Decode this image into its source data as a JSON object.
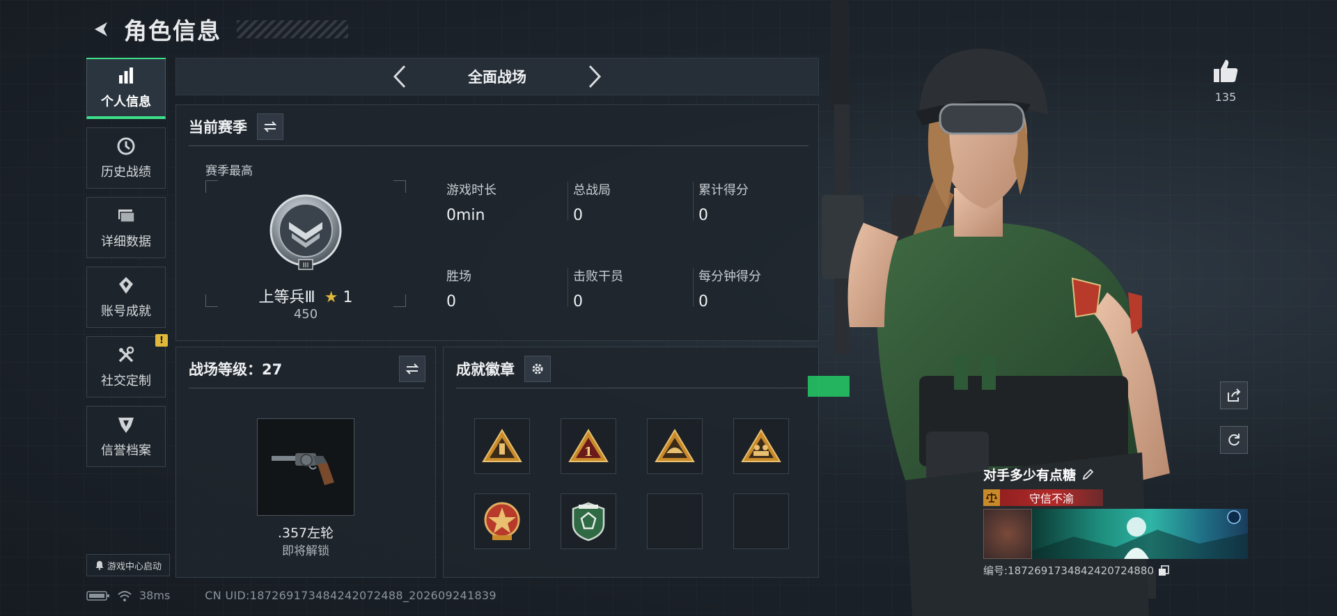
{
  "header": {
    "title": "角色信息"
  },
  "sidebar": {
    "items": [
      {
        "label": "个人信息",
        "icon": "bar-chart-icon"
      },
      {
        "label": "历史战绩",
        "icon": "clock-icon"
      },
      {
        "label": "详细数据",
        "icon": "folder-icon"
      },
      {
        "label": "账号成就",
        "icon": "achievement-icon"
      },
      {
        "label": "社交定制",
        "icon": "tools-icon",
        "badge": "!"
      },
      {
        "label": "信誉档案",
        "icon": "credit-shield-icon"
      }
    ],
    "launch_label": "游戏中心启动"
  },
  "mode_bar": {
    "title": "全面战场"
  },
  "season_panel": {
    "title": "当前赛季",
    "best_label": "赛季最高",
    "rank_name": "上等兵Ⅲ",
    "rank_stars": "1",
    "rank_score": "450",
    "stats": [
      {
        "label": "游戏时长",
        "value": "0min"
      },
      {
        "label": "总战局",
        "value": "0"
      },
      {
        "label": "累计得分",
        "value": "0"
      },
      {
        "label": "胜场",
        "value": "0"
      },
      {
        "label": "击败干员",
        "value": "0"
      },
      {
        "label": "每分钟得分",
        "value": "0"
      }
    ]
  },
  "level_panel": {
    "title": "战场等级：27",
    "weapon_name": ".357左轮",
    "weapon_status": "即将解锁"
  },
  "badge_panel": {
    "title": "成就徽章",
    "badges": [
      "badge-flag",
      "badge-number-one",
      "badge-helmet",
      "badge-squad",
      "badge-star-medal",
      "badge-green-shield",
      "empty",
      "empty"
    ]
  },
  "character": {
    "likes": "135",
    "player_name": "对手多少有点糖",
    "title_badge": "守信不渝",
    "player_id": "编号:1872691734842420724880"
  },
  "status_bar": {
    "ping": "38ms",
    "uid": "CN UID:18726917348424207​2488_202609241839"
  },
  "colors": {
    "accent": "#3de08a",
    "warning": "#e0b83a",
    "title_red": "#b22a2a"
  }
}
